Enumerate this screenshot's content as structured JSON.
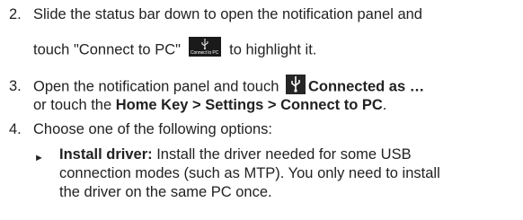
{
  "steps": {
    "s2": {
      "number": "2.",
      "line1": "Slide the status bar down to open the notification panel and",
      "line2_before": "touch \"Connect to PC\"",
      "icon_caption": "Connect to PC",
      "line2_after": "to highlight it."
    },
    "s3": {
      "number": "3.",
      "line1_before": "Open the notification panel and touch",
      "line1_bold": "Connected as …",
      "line2_before": "or touch the ",
      "line2_bold": "Home Key > Settings > Connect to PC",
      "line2_after": "."
    },
    "s4": {
      "number": "4.",
      "text": "Choose one of the following options:"
    }
  },
  "options": [
    {
      "bullet": "►",
      "title": "Install driver:",
      "line1": " Install the driver needed for some USB",
      "line2": "connection modes (such as MTP). You only need to install",
      "line3": "the driver on the same PC once."
    }
  ],
  "icons": {
    "connect_to_pc": "usb-connect-to-pc-icon",
    "usb": "usb-icon"
  },
  "colors": {
    "text": "#222222",
    "icon_bg": "#1a1a1a",
    "icon_fg": "#ffffff"
  }
}
